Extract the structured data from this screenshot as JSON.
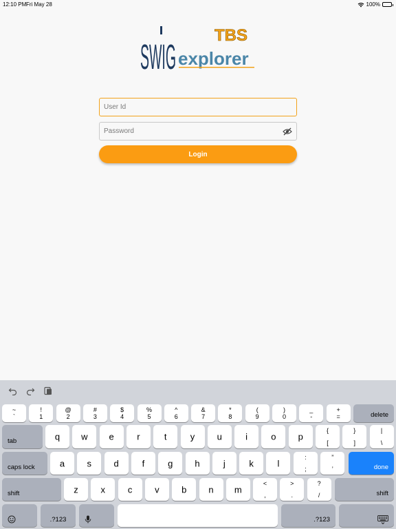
{
  "status_bar": {
    "time": "12:10 PM",
    "date": "Fri May 28",
    "battery": "100%"
  },
  "logo": {
    "swig": "SWIG",
    "tbs": "TBS",
    "explorer": "explorer"
  },
  "form": {
    "user_placeholder": "User Id",
    "password_placeholder": "Password",
    "login_label": "Login"
  },
  "colors": {
    "accent": "#fb9c12",
    "done_key": "#1a82fb",
    "logo_navy": "#1e3a5f",
    "logo_teal": "#4b86a8"
  },
  "keyboard": {
    "row1": [
      [
        "~",
        "`"
      ],
      [
        "!",
        "1"
      ],
      [
        "@",
        "2"
      ],
      [
        "#",
        "3"
      ],
      [
        "$",
        "4"
      ],
      [
        "%",
        "5"
      ],
      [
        "^",
        "6"
      ],
      [
        "&",
        "7"
      ],
      [
        "*",
        "8"
      ],
      [
        "(",
        "9"
      ],
      [
        ")",
        "0"
      ],
      [
        "_",
        "-"
      ],
      [
        "+",
        "="
      ]
    ],
    "delete": "delete",
    "tab": "tab",
    "row2": [
      "q",
      "w",
      "e",
      "r",
      "t",
      "y",
      "u",
      "i",
      "o",
      "p"
    ],
    "row2_sym": [
      [
        "{",
        "["
      ],
      [
        "}",
        "]"
      ],
      [
        "|",
        "\\"
      ]
    ],
    "caps": "caps lock",
    "row3": [
      "a",
      "s",
      "d",
      "f",
      "g",
      "h",
      "j",
      "k",
      "l"
    ],
    "row3_sym": [
      [
        ":",
        ";"
      ],
      [
        "”",
        "’"
      ]
    ],
    "done": "done",
    "shift": "shift",
    "row4": [
      "z",
      "x",
      "c",
      "v",
      "b",
      "n",
      "m"
    ],
    "row4_sym": [
      [
        "<",
        ","
      ],
      [
        ">",
        "."
      ],
      [
        "?",
        "/"
      ]
    ],
    "num": ".?123"
  }
}
